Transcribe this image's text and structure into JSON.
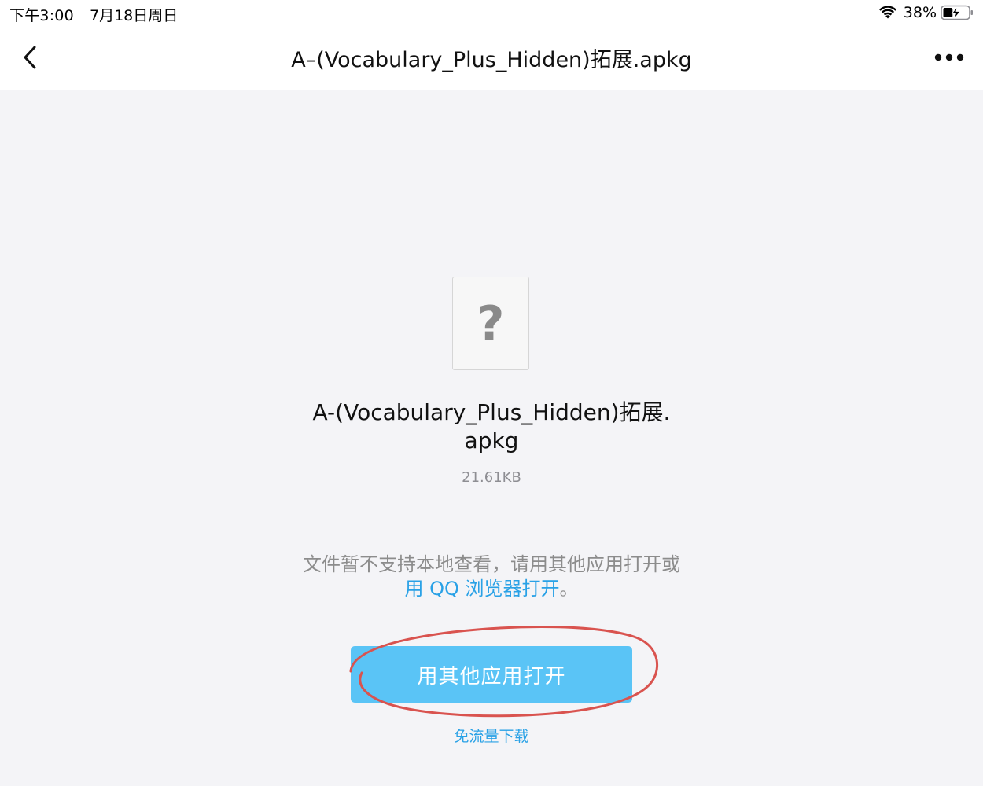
{
  "status_bar": {
    "time": "下午3:00",
    "date": "7月18日周日",
    "battery_percent": "38%",
    "battery_level": 0.38,
    "wifi_icon": "wifi-icon",
    "battery_icon": "battery-charging-icon"
  },
  "nav": {
    "back_icon": "chevron-left-icon",
    "title": "A–(Vocabulary_Plus_Hidden)拓展.apkg",
    "more_icon": "more-dots-icon"
  },
  "file": {
    "icon": "unknown-file-icon",
    "icon_glyph": "?",
    "name": "A-(Vocabulary_Plus_Hidden)拓展.apkg",
    "size": "21.61KB"
  },
  "notice": {
    "text_before": "文件暂不支持本地查看，请用其他应用打开或",
    "link_text": "用 QQ 浏览器打开",
    "text_after": "。"
  },
  "actions": {
    "open_with_other_app": "用其他应用打开",
    "free_download": "免流量下载"
  },
  "colors": {
    "accent": "#29a1e6",
    "button": "#5ac4f6",
    "annotation": "#d9534f",
    "background": "#f4f4f7"
  }
}
